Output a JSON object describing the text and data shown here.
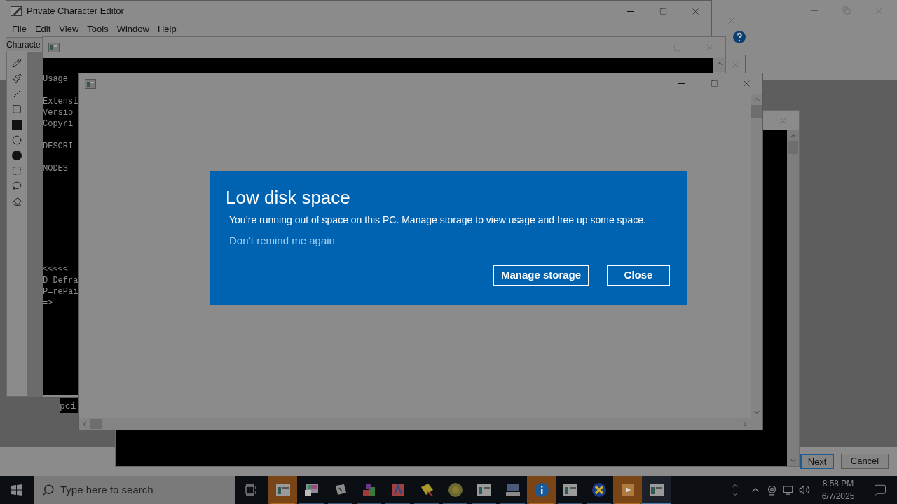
{
  "editor": {
    "title": "Private Character Editor",
    "menu": [
      "File",
      "Edit",
      "View",
      "Tools",
      "Window",
      "Help"
    ],
    "tab": "Characte"
  },
  "console": {
    "lines": [
      "Usage",
      "Extensi",
      "Versio",
      "Copyri",
      "DESCRI",
      "MODES",
      "<<<<<",
      "D=Defra",
      "P=rePai",
      "=>"
    ]
  },
  "back_console": {
    "lines": [
      "pci"
    ]
  },
  "wizard": {
    "buttons": [
      {
        "label": "Next",
        "default": true
      },
      {
        "label": "Cancel",
        "default": false
      }
    ]
  },
  "dialog": {
    "title": "Low disk space",
    "message": "You’re running out of space on this PC. Manage storage to view usage and free up some space.",
    "link": "Don’t remind me again",
    "buttons": [
      "Manage storage",
      "Close"
    ]
  },
  "taskbar": {
    "search": {
      "placeholder": "Type here to search"
    },
    "apps": [
      {
        "flashing": true,
        "active": false
      },
      {
        "flashing": false,
        "active": false
      },
      {
        "flashing": false,
        "active": false
      },
      {
        "flashing": false,
        "active": false
      },
      {
        "flashing": false,
        "active": false
      },
      {
        "flashing": false,
        "active": false
      },
      {
        "flashing": false,
        "active": false
      },
      {
        "flashing": false,
        "active": false
      },
      {
        "flashing": false,
        "active": false
      },
      {
        "flashing": true,
        "active": false
      },
      {
        "flashing": false,
        "active": false
      },
      {
        "flashing": false,
        "active": false
      },
      {
        "flashing": true,
        "active": false
      },
      {
        "flashing": false,
        "active": true
      }
    ],
    "clock": {
      "time": "8:58 PM",
      "date": "6/7/2025"
    }
  }
}
